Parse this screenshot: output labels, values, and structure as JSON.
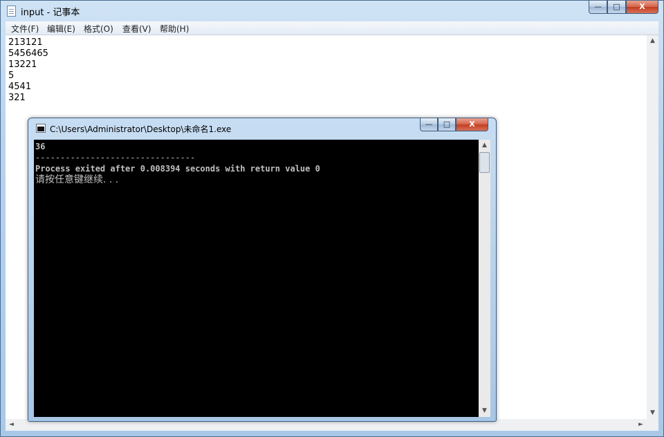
{
  "notepad": {
    "title": "input - 记事本",
    "menu": [
      "文件(F)",
      "编辑(E)",
      "格式(O)",
      "查看(V)",
      "帮助(H)"
    ],
    "content": "213121\n5456465\n13221\n5\n4541\n321"
  },
  "console": {
    "title": "C:\\Users\\Administrator\\Desktop\\未命名1.exe",
    "output_line1": "36",
    "separator": "--------------------------------",
    "process_line": "Process exited after 0.008394 seconds with return value 0",
    "prompt_line": "请按任意键继续. . ."
  },
  "caption_glyphs": {
    "minimize": "—",
    "maximize": "□",
    "close": "X"
  },
  "scroll_glyphs": {
    "up": "▲",
    "down": "▼",
    "left": "◄",
    "right": "►"
  }
}
